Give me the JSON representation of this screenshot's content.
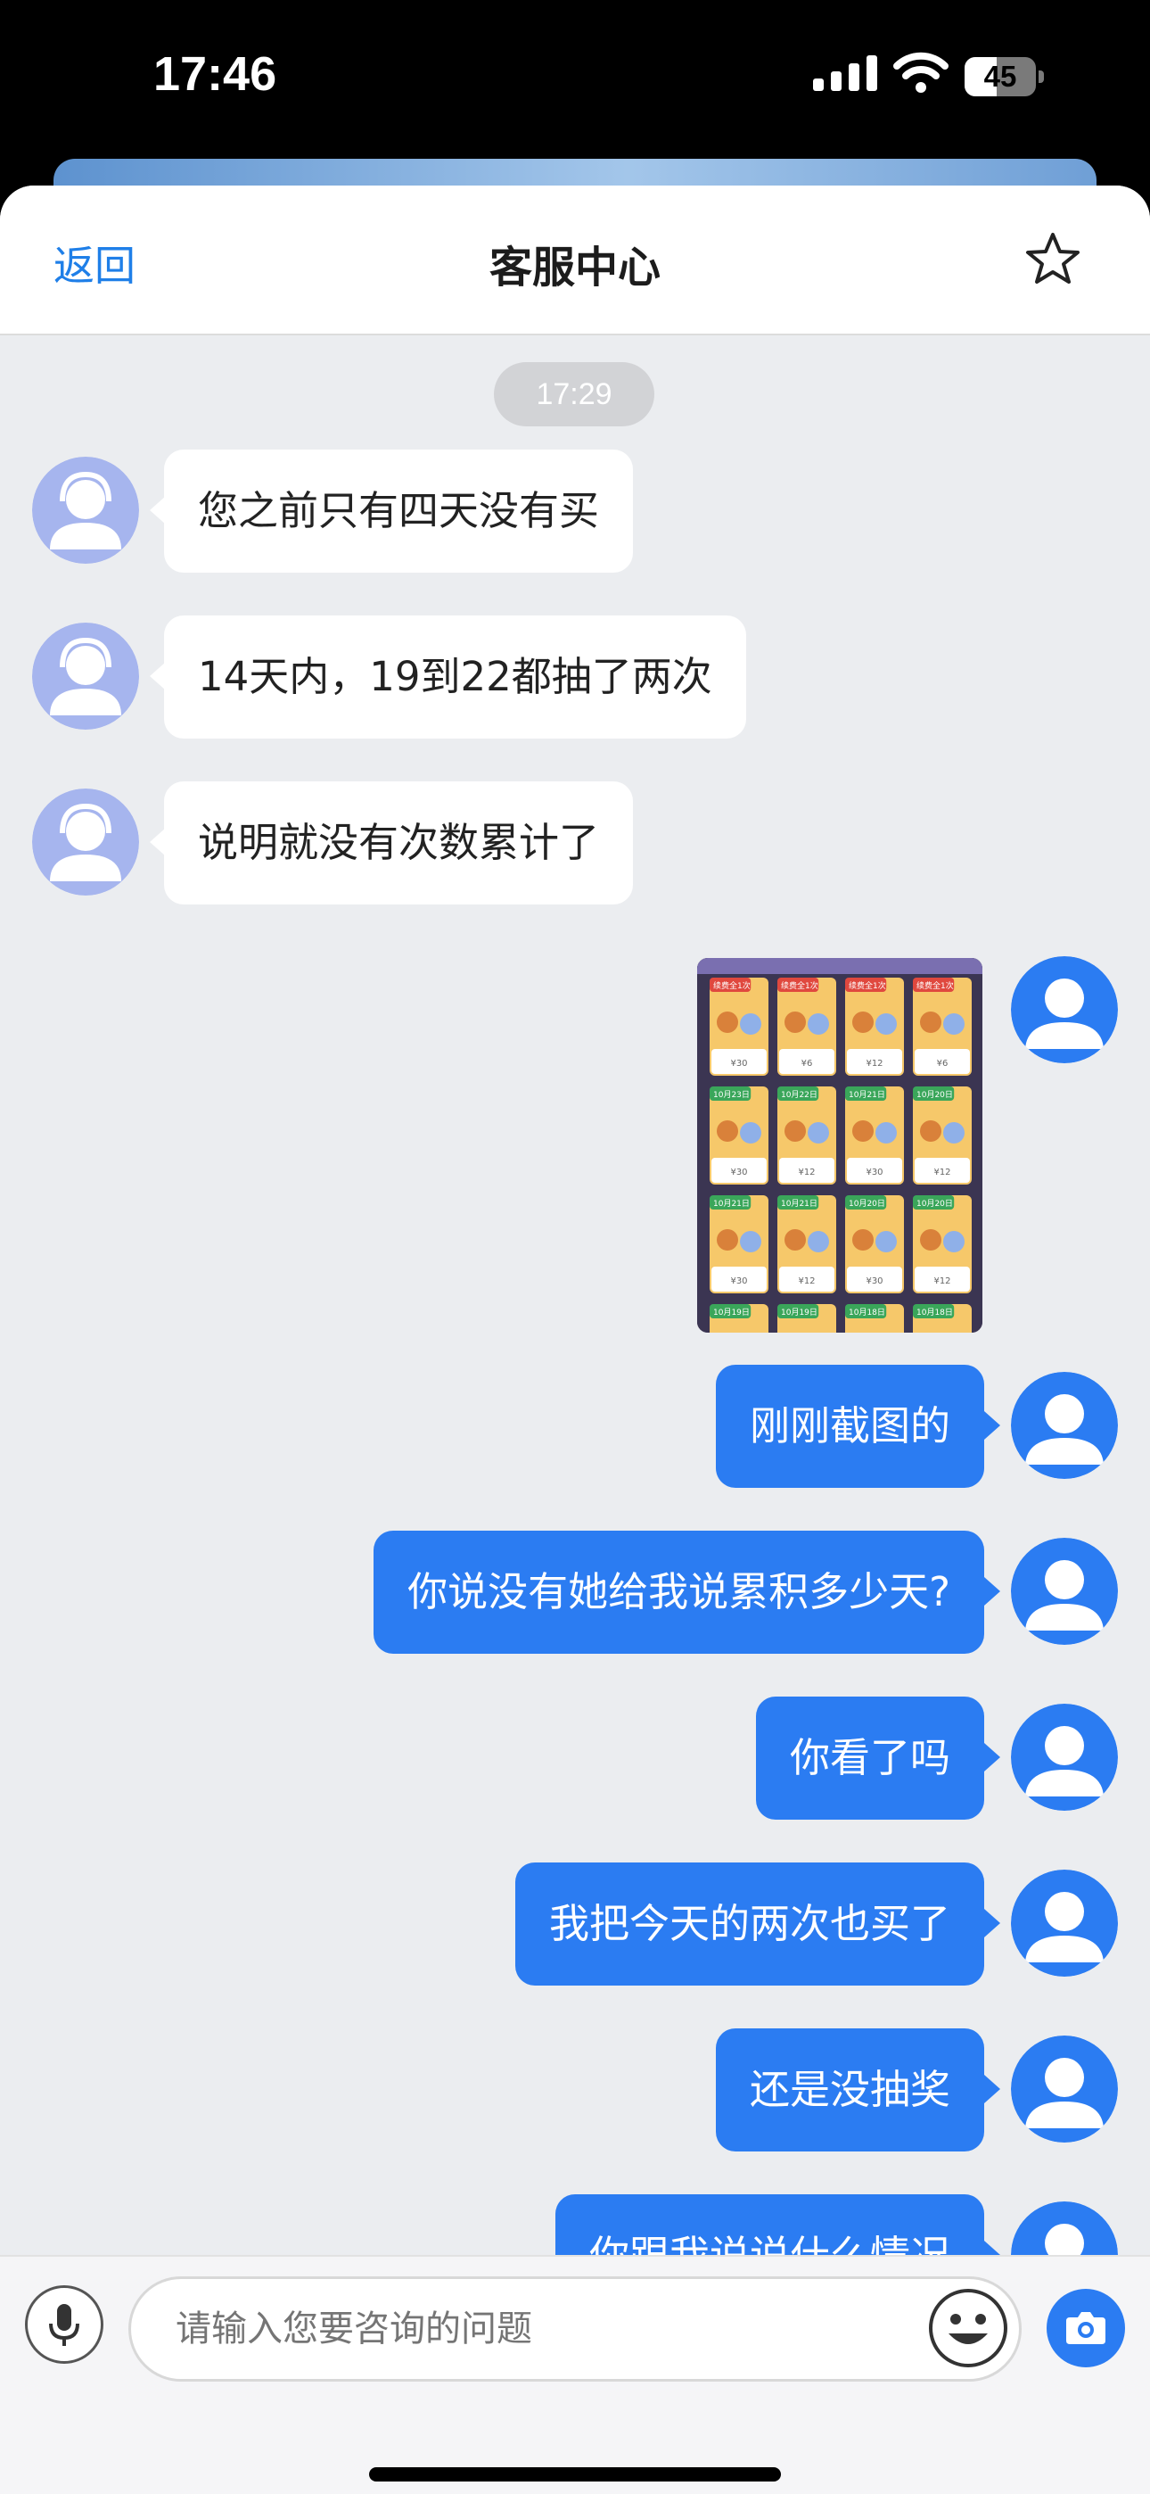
{
  "status_bar": {
    "time": "17:46",
    "battery": "45"
  },
  "nav": {
    "back_label": "返回",
    "title": "客服中心"
  },
  "chat": {
    "timestamp": "17:29",
    "agent_messages": [
      "您之前只有四天没有买",
      "14天内，19到22都抽了两次",
      "说明就没有次数累计了"
    ],
    "screenshot_tiles": {
      "tags": [
        "续费全1次",
        "续费全1次",
        "续费全1次",
        "续费全1次",
        "10月23日",
        "10月22日",
        "10月21日",
        "10月20日",
        "10月21日",
        "10月21日",
        "10月20日",
        "10月20日",
        "10月19日",
        "10月19日",
        "10月18日",
        "10月18日"
      ],
      "prices": [
        "¥30",
        "¥6",
        "¥12",
        "¥6",
        "¥30",
        "¥12",
        "¥30",
        "¥12",
        "¥30",
        "¥12",
        "¥30",
        "¥12"
      ]
    },
    "user_messages": [
      "刚刚截图的",
      "你说没有她给我说累积多少天?",
      "你看了吗",
      "我把今天的两次也买了",
      "还是没抽奖",
      "你跟我说说什么情况"
    ]
  },
  "input": {
    "placeholder": "请输入您要咨询的问题"
  },
  "colors": {
    "accent": "#2b7cf2",
    "background": "#ebedf0",
    "agent_avatar": "#a6b5ee",
    "user_avatar": "#2b7cf2"
  },
  "icons": [
    "star-icon",
    "microphone-icon",
    "emoji-icon",
    "camera-icon",
    "wifi-icon",
    "signal-icon",
    "battery-icon",
    "agent-avatar-icon",
    "user-avatar-icon"
  ]
}
